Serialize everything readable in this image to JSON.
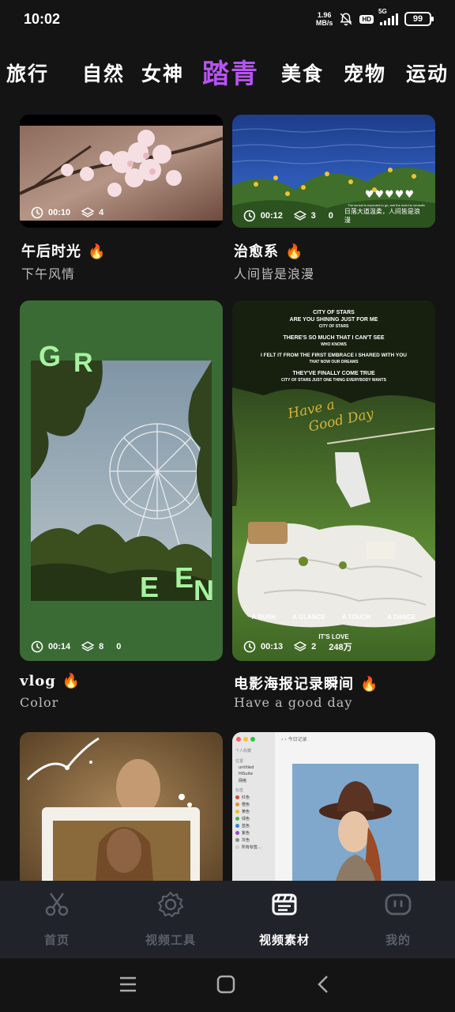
{
  "status_bar": {
    "time": "10:02",
    "net_speed_value": "1.96",
    "net_speed_unit": "MB/s",
    "hd": "HD",
    "signal_label": "5G",
    "battery": "99"
  },
  "categories": [
    {
      "label": "旅行",
      "active": false
    },
    {
      "label": "自然",
      "active": false
    },
    {
      "label": "女神",
      "active": false
    },
    {
      "label": "踏青",
      "active": true
    },
    {
      "label": "美食",
      "active": false
    },
    {
      "label": "宠物",
      "active": false
    },
    {
      "label": "运动",
      "active": false
    }
  ],
  "cards": [
    {
      "title": "午后时光",
      "subtitle": "下午风情",
      "duration": "00:10",
      "layers": "4",
      "count": "",
      "hot": true
    },
    {
      "title": "治愈系",
      "subtitle": "人间皆是浪漫",
      "duration": "00:12",
      "layers": "3",
      "count": "0",
      "hot": true,
      "overlay_text": "日落大道温柔，人间皆是浪漫",
      "hearts": "♥♥♥♥♥",
      "overlay_small": "The sunset is expected to go, and the world is romantic"
    },
    {
      "title": "vlog",
      "subtitle": "Color",
      "duration": "00:14",
      "layers": "8",
      "count": "0",
      "hot": true,
      "letters": [
        "G",
        "R",
        "E",
        "E",
        "N"
      ]
    },
    {
      "title": "电影海报记录瞬间",
      "subtitle": "Have a good day",
      "duration": "00:13",
      "layers": "2",
      "count": "248万",
      "hot": true,
      "poster": {
        "line1": "CITY OF STARS",
        "line2": "ARE YOU SHINING JUST FOR ME",
        "line3": "CITY OF STARS",
        "line4": "THERE'S SO MUCH THAT I CAN'T SEE",
        "line5": "WHO KNOWS",
        "line6": "I FELT IT FROM THE FIRST EMBRACE I SHARED WITH YOU",
        "line7": "THAT NOW OUR DREAMS",
        "line8": "THEY'VE FINALLY COME TRUE",
        "line9": "CITY OF STARS JUST ONE THING EVERYBODY WANTS",
        "script1": "Have a",
        "script2": "Good Day",
        "bottom1": "A RUSH",
        "bottom2": "A GLANCE",
        "bottom3": "A TOUCH",
        "bottom4": "A DANCE",
        "bottom5": "IT'S LOVE"
      }
    },
    {
      "title": "",
      "subtitle": "",
      "duration": "",
      "layers": "",
      "count": "",
      "hot": false
    },
    {
      "title": "",
      "subtitle": "",
      "duration": "",
      "layers": "",
      "count": "",
      "hot": false,
      "mac": {
        "path": "今日记录",
        "section1": "个人收藏",
        "section2": "位置",
        "loc1": "untitled",
        "loc2": "HiSuite",
        "loc3": "网络",
        "section3": "标签",
        "tags": [
          {
            "name": "红色",
            "color": "#e0443a"
          },
          {
            "name": "橙色",
            "color": "#f0902a"
          },
          {
            "name": "黄色",
            "color": "#e8c02a"
          },
          {
            "name": "绿色",
            "color": "#42b84a"
          },
          {
            "name": "蓝色",
            "color": "#3a82e0"
          },
          {
            "name": "紫色",
            "color": "#9a4ad0"
          },
          {
            "name": "灰色",
            "color": "#8a8a8a"
          },
          {
            "name": "所有标签…",
            "color": "#cccccc"
          }
        ]
      }
    }
  ],
  "bottom_nav": [
    {
      "label": "首页",
      "icon": "scissors-icon",
      "active": false
    },
    {
      "label": "视频工具",
      "icon": "gear-icon",
      "active": false
    },
    {
      "label": "视频素材",
      "icon": "clapperboard-icon",
      "active": true
    },
    {
      "label": "我的",
      "icon": "robot-face-icon",
      "active": false
    }
  ],
  "colors": {
    "background": "#141414",
    "accent": "#b654f0",
    "nav_background": "#20232a",
    "fire": "#ff8a1d",
    "green_letters": "#a6f2a0"
  }
}
